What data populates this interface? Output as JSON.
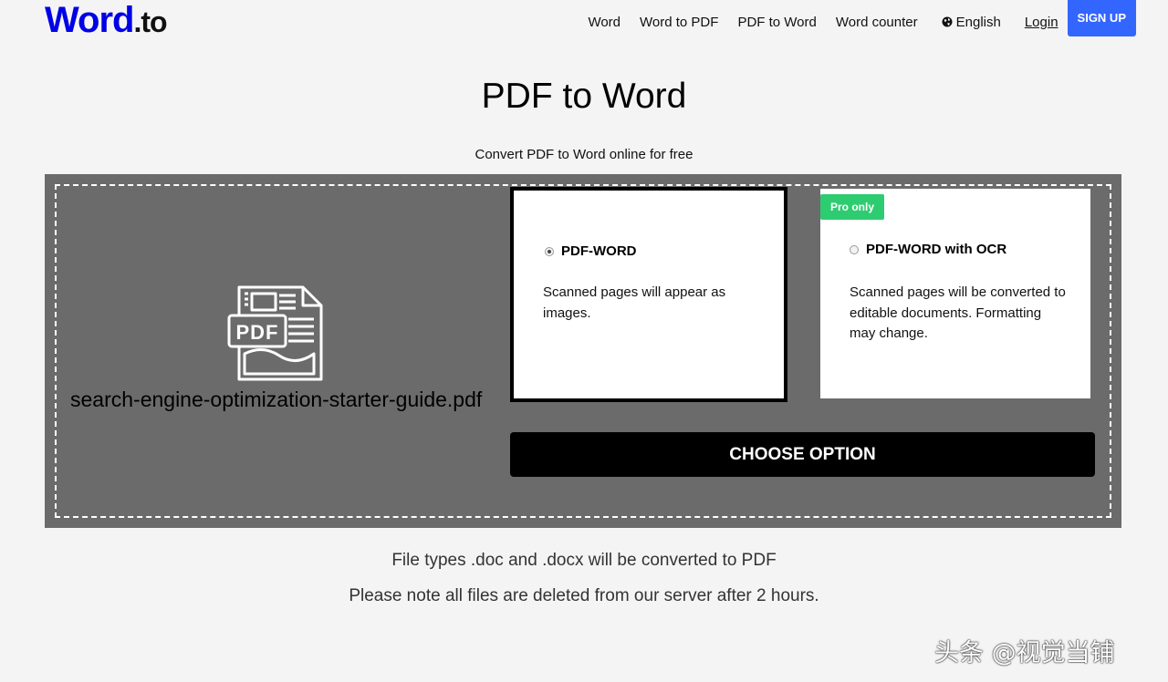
{
  "logo": {
    "brand": "Word",
    "tld": ".to"
  },
  "nav": {
    "items": [
      "Word",
      "Word to PDF",
      "PDF to Word",
      "Word counter"
    ],
    "language": "English",
    "login": "Login",
    "signup": "SIGN UP"
  },
  "page": {
    "title": "PDF to Word",
    "subtitle": "Convert PDF to Word online for free"
  },
  "upload": {
    "icon": "pdf-document-icon",
    "icon_text": "PDF",
    "file_name": "search-engine-optimization-starter-guide.pdf"
  },
  "options": [
    {
      "label": "PDF-WORD",
      "description": "Scanned pages will appear as images.",
      "selected": true
    },
    {
      "label": "PDF-WORD with OCR",
      "description": "Scanned pages will be converted to editable documents. Formatting may change.",
      "badge": "Pro only",
      "selected": false
    }
  ],
  "action": {
    "button": "CHOOSE OPTION"
  },
  "notes": {
    "file_types": "File types .doc and .docx will be converted to PDF",
    "deletion": "Please note all files are deleted from our server after 2 hours."
  },
  "watermark": "头条 @视觉当铺",
  "colors": {
    "brand": "#0000e6",
    "signup": "#3366ff",
    "panel": "#6b6b6b",
    "badge": "#2ecc71",
    "button": "#000000"
  }
}
